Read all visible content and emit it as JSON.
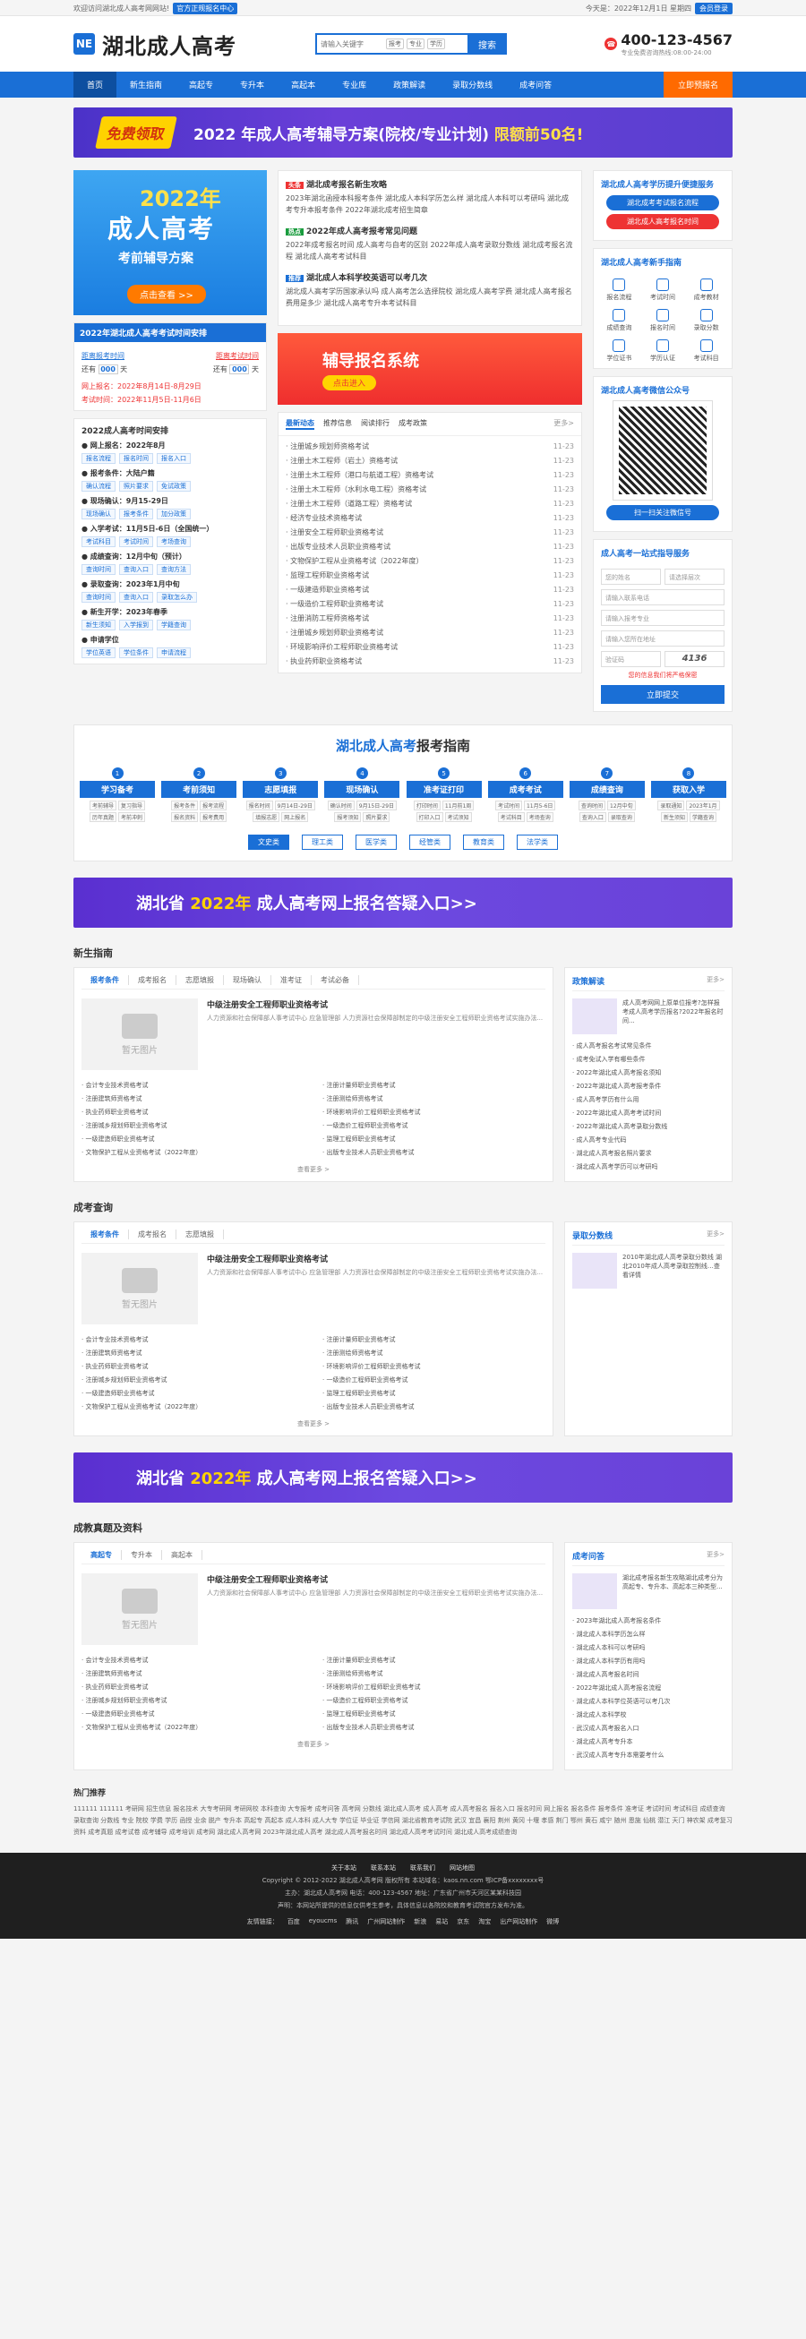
{
  "topbar": {
    "welcome": "欢迎访问湖北成人高考网网站!",
    "jump": "官方正规报名中心",
    "date_label": "今天是：2022年12月1日 星期四",
    "login": "会员登录"
  },
  "header": {
    "logo_mark": "NE",
    "site_name": "湖北成人高考",
    "search_placeholder": "请输入关键字",
    "search_tags": [
      "报考",
      "专业",
      "学历"
    ],
    "search_btn": "搜索",
    "phone": "400-123-4567",
    "phone_sub": "专业免费咨询热线:08:00-24:00"
  },
  "nav": {
    "items": [
      "首页",
      "新生指南",
      "高起专",
      "专升本",
      "高起本",
      "专业库",
      "政策解读",
      "录取分数线",
      "成考问答"
    ],
    "cta": "立即预报名"
  },
  "banner": {
    "badge": "免费领取",
    "text_pre": "2022 年成人高考辅导方案",
    "text_mid": "(院校/专业计划)",
    "text_hl": "限额前50名!"
  },
  "promo": {
    "year": "2022年",
    "title": "成人高考",
    "sub": "考前辅导方案",
    "btn": "点击查看 >>"
  },
  "countdown": {
    "title": "2022年湖北成人高考考试时间安排",
    "lab1": "距离报考时间",
    "lab2": "距离考试时间",
    "still": "还有",
    "d1": "000",
    "d2": "000",
    "unit": "天",
    "reg": "网上报名：2022年8月14日-8月29日",
    "exam": "考试时间：2022年11月5日-11月6日"
  },
  "schedule": {
    "title": "2022成人高考时间安排",
    "items": [
      {
        "t": "网上报名：2022年8月",
        "tags": [
          "报名流程",
          "报名时间",
          "报名入口"
        ]
      },
      {
        "t": "报考条件：大陆户籍",
        "tags": [
          "确认流程",
          "照片要求",
          "免试政策"
        ]
      },
      {
        "t": "现场确认：9月15-29日",
        "tags": [
          "现场确认",
          "报考条件",
          "加分政策"
        ]
      },
      {
        "t": "入学考试：11月5日-6日（全国统一）",
        "tags": [
          "考试科目",
          "考试时间",
          "考场查询"
        ]
      },
      {
        "t": "成绩查询：12月中旬（预计）",
        "tags": [
          "查询时间",
          "查询入口",
          "查询方法"
        ]
      },
      {
        "t": "录取查询：2023年1月中旬",
        "tags": [
          "查询时间",
          "查询入口",
          "录取怎么办"
        ]
      },
      {
        "t": "新生开学：2023年春季",
        "tags": [
          "新生须知",
          "入学报到",
          "学籍查询"
        ]
      },
      {
        "t": "申请学位",
        "tags": [
          "学位英语",
          "学位条件",
          "申请流程"
        ]
      }
    ]
  },
  "mid": {
    "blocks": [
      {
        "badge": "头条",
        "color": "#e33",
        "title": "湖北成考报名新生攻略",
        "lines": [
          "2023年湖北函授本科报考条件",
          "湖北成人本科学历怎么样",
          "湖北成人本科可以考研吗",
          "湖北成考专升本报考条件",
          "2022年湖北成考招生简章"
        ]
      },
      {
        "badge": "热点",
        "color": "#1a9c3e",
        "title": "2022年成人高考报考常见问题",
        "lines": [
          "2022年成考报名时间",
          "成人高考与自考的区别",
          "2022年成人高考录取分数线",
          "湖北成考报名流程",
          "湖北成人高考考试科目"
        ]
      },
      {
        "badge": "推荐",
        "color": "#1a6fd6",
        "title": "湖北成人本科学校英语可以考几次",
        "lines": [
          "湖北成人高考学历国家承认吗",
          "成人高考怎么选择院校",
          "湖北成人高考学费",
          "湖北成人高考报名费用是多少",
          "湖北成人高考专升本考试科目"
        ]
      }
    ],
    "reg_title": "辅导报名系统",
    "reg_btn": "点击进入",
    "tabs": [
      "最新动态",
      "推荐信息",
      "阅读排行",
      "成考政策"
    ],
    "more": "更多>",
    "list": [
      {
        "t": "注册城乡规划师资格考试",
        "d": "11-23"
      },
      {
        "t": "注册土木工程师（岩土）资格考试",
        "d": "11-23"
      },
      {
        "t": "注册土木工程师（港口与航道工程）资格考试",
        "d": "11-23"
      },
      {
        "t": "注册土木工程师（水利水电工程）资格考试",
        "d": "11-23"
      },
      {
        "t": "注册土木工程师（道路工程）资格考试",
        "d": "11-23"
      },
      {
        "t": "经济专业技术资格考试",
        "d": "11-23"
      },
      {
        "t": "注册安全工程师职业资格考试",
        "d": "11-23"
      },
      {
        "t": "出版专业技术人员职业资格考试",
        "d": "11-23"
      },
      {
        "t": "文物保护工程从业资格考试（2022年度）",
        "d": "11-23"
      },
      {
        "t": "监理工程师职业资格考试",
        "d": "11-23"
      },
      {
        "t": "一级建造师职业资格考试",
        "d": "11-23"
      },
      {
        "t": "一级造价工程师职业资格考试",
        "d": "11-23"
      },
      {
        "t": "注册消防工程师资格考试",
        "d": "11-23"
      },
      {
        "t": "注册城乡规划师职业资格考试",
        "d": "11-23"
      },
      {
        "t": "环境影响评价工程师职业资格考试",
        "d": "11-23"
      },
      {
        "t": "执业药师职业资格考试",
        "d": "11-23"
      }
    ]
  },
  "right": {
    "card1_title": "湖北成人高考学历提升便捷服务",
    "btn1": "湖北成考考试报名流程",
    "btn2": "湖北成人高考报名时间",
    "guide_title": "湖北成人高考新手指南",
    "icons": [
      "报名流程",
      "考试时间",
      "成考教材",
      "成绩查询",
      "报名时间",
      "录取分数",
      "学位证书",
      "学历认证",
      "考试科目"
    ],
    "wx_title": "湖北成人高考微信公众号",
    "wx_btn": "扫一扫关注微信号",
    "svc_title": "成人高考一站式指导服务",
    "f_name": "您的姓名",
    "f_level": "请选择层次",
    "f_phone": "请输入联系电话",
    "f_major": "请输入报考专业",
    "f_addr": "请输入您所在地址",
    "f_code": "验证码",
    "code": "4136",
    "note": "您的信息我们将严格保密",
    "submit": "立即提交"
  },
  "guide": {
    "title_hl": "湖北成人高考",
    "title_rest": "报考指南",
    "steps": [
      {
        "n": "1",
        "label": "学习备考",
        "subs": [
          "考前辅导",
          "复习指导",
          "历年真题",
          "考前冲刺"
        ]
      },
      {
        "n": "2",
        "label": "考前须知",
        "subs": [
          "报考条件",
          "报考流程",
          "报名资料",
          "报考费用"
        ]
      },
      {
        "n": "3",
        "label": "志愿填报",
        "subs": [
          "报名时间",
          "9月14日-29日",
          "填报志愿",
          "网上报名"
        ]
      },
      {
        "n": "4",
        "label": "现场确认",
        "subs": [
          "确认时间",
          "9月15日-29日",
          "报考须知",
          "照片要求"
        ]
      },
      {
        "n": "5",
        "label": "准考证打印",
        "subs": [
          "打印时间",
          "11月前1周",
          "打印入口",
          "考试须知"
        ]
      },
      {
        "n": "6",
        "label": "成考考试",
        "subs": [
          "考试时间",
          "11月5-6日",
          "考试科目",
          "考场查询"
        ]
      },
      {
        "n": "7",
        "label": "成绩查询",
        "subs": [
          "查询时间",
          "12月中旬",
          "查询入口",
          "录取查询"
        ]
      },
      {
        "n": "8",
        "label": "获取入学",
        "subs": [
          "录取通知",
          "2023年1月",
          "新生须知",
          "学籍查询"
        ]
      }
    ],
    "subtabs": [
      "文史类",
      "理工类",
      "医学类",
      "经管类",
      "教育类",
      "法学类"
    ]
  },
  "wide_banner": {
    "pre": "湖北省 ",
    "year": "2022年",
    "post": " 成人高考网上报名答疑入口>>"
  },
  "sections": [
    {
      "title": "新生指南",
      "tabs": [
        "报考条件",
        "成考报名",
        "志愿填报",
        "现场确认",
        "准考证",
        "考试必备"
      ],
      "side_title": "政策解读",
      "side_more": "更多>",
      "side_feat": "成人高考网网上原单位报考?怎样报考成人高考学历报名?2022年报名时间...",
      "side_list": [
        "成人高考报名考试常见条件",
        "成考免试入学有哪些条件",
        "2022年湖北成人高考报名须知",
        "2022年湖北成人高考报考条件",
        "成人高考学历有什么用",
        "2022年湖北成人高考考试时间",
        "2022年湖北成人高考录取分数线",
        "成人高考专业代码",
        "湖北成人高考报名照片要求",
        "湖北成人高考学历可以考研吗"
      ]
    },
    {
      "title": "成考查询",
      "tabs": [
        "报考条件",
        "成考报名",
        "志愿填报"
      ],
      "side_title": "录取分数线",
      "side_more": "更多>",
      "side_feat": "2010年湖北成人高考录取分数线 湖北2010年成人高考录取控制线…查看详情",
      "side_list": []
    },
    {
      "title": "成教真题及资料",
      "tabs": [
        "高起专",
        "专升本",
        "高起本"
      ],
      "side_title": "成考问答",
      "side_more": "更多>",
      "side_feat": "湖北成考报名新生攻略湖北成考分为高起专、专升本、高起本三种类型...",
      "side_list": [
        "2023年湖北成人高考报名条件",
        "湖北成人本科学历怎么样",
        "湖北成人本科可以考研吗",
        "湖北成人本科学历有用吗",
        "湖北成人高考报名时间",
        "2022年湖北成人高考报名流程",
        "湖北成人本科学位英语可以考几次",
        "湖北成人本科学校",
        "武汉成人高考报名入口",
        "湖北成人高考专升本",
        "武汉成人高考专升本需要考什么"
      ]
    }
  ],
  "feat": {
    "noimg": "暂无图片",
    "title": "中级注册安全工程师职业资格考试",
    "desc": "人力资源和社会保障部人事考试中心 应急管理部 人力资源社会保障部制定的中级注册安全工程师职业资格考试实施办法...",
    "more": "查看更多 >"
  },
  "feat_list": [
    "会计专业技术资格考试",
    "注册计量师职业资格考试",
    "注册建筑师资格考试",
    "注册测绘师资格考试",
    "执业药师职业资格考试",
    "环境影响评价工程师职业资格考试",
    "注册城乡规划师职业资格考试",
    "一级造价工程师职业资格考试",
    "一级建造师职业资格考试",
    "监理工程师职业资格考试",
    "文物保护工程从业资格考试（2022年度）",
    "出版专业技术人员职业资格考试"
  ],
  "hot": {
    "title": "热门推荐",
    "text": "111111 111111 考研网 招生信息 报名技术 大专考研网 考研网校 本科查询 大专报考 成考问答 高考网 分数线 湖北成人高考 成人高考 成人高考报名 报名入口 报名时间 网上报名 报名条件 报考条件 准考证 考试时间 考试科目 成绩查询 录取查询 分数线 专业 院校 学费 学历 函授 业余 脱产 专升本 高起专 高起本 成人本科 成人大专 学位证 毕业证 学信网 湖北省教育考试院 武汉 宜昌 襄阳 荆州 黄冈 十堰 孝感 荆门 鄂州 黄石 咸宁 随州 恩施 仙桃 潜江 天门 神农架 成考复习资料 成考真题 成考试卷 成考辅导 成考培训 成考网 湖北成人高考网 2023年湖北成人高考 湖北成人高考报名时间 湖北成人高考考试时间 湖北成人高考成绩查询"
  },
  "footer": {
    "links": [
      "关于本站",
      "联系本站",
      "联系我们",
      "网站地图"
    ],
    "copy": "Copyright © 2012-2022 湖北成人高考网 版权所有 本站域名：kaos.nn.com 鄂ICP备xxxxxxxx号",
    "contact": "主办：湖北成人高考网  电话：400-123-4567  地址：广东省广州市天河区某某科技园",
    "notice": "声明：本网站所提供的信息仅供考生参考，具体信息以各院校和教育考试院官方发布为准。",
    "friend_label": "友情链接：",
    "friends": [
      "百度",
      "eyoucms",
      "腾讯",
      "广州网站制作",
      "新浪",
      "易站",
      "京东",
      "淘宝",
      "出产网站制作",
      "微博"
    ]
  }
}
